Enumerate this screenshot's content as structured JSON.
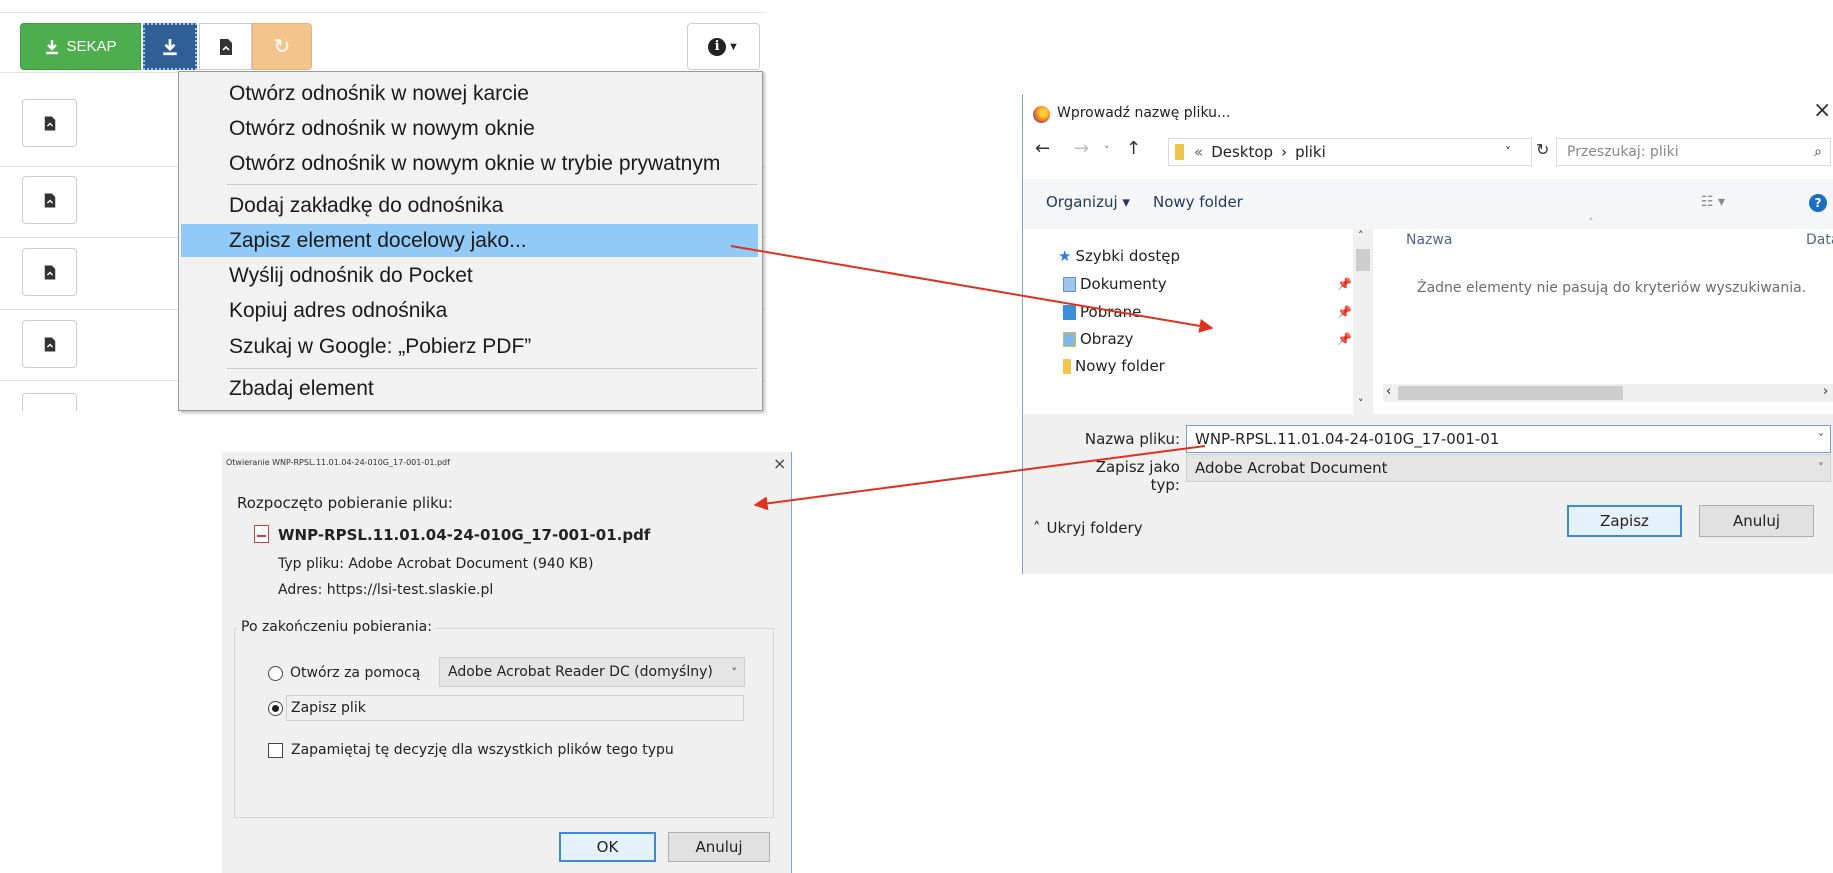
{
  "toolbar": {
    "sekap_label": "SEKAP",
    "refresh_icon": "↻",
    "info_icon": "i"
  },
  "context_menu": {
    "items": [
      {
        "label": "Otwórz odnośnik w nowej karcie",
        "highlighted": false
      },
      {
        "label": "Otwórz odnośnik w nowym oknie",
        "highlighted": false
      },
      {
        "label": "Otwórz odnośnik w nowym oknie w trybie prywatnym",
        "highlighted": false
      },
      {
        "label": "Dodaj zakładkę do odnośnika",
        "highlighted": false
      },
      {
        "label": "Zapisz element docelowy jako...",
        "highlighted": true
      },
      {
        "label": "Wyślij odnośnik do Pocket",
        "highlighted": false
      },
      {
        "label": "Kopiuj adres odnośnika",
        "highlighted": false
      },
      {
        "label": "Szukaj w Google: „Pobierz PDF”",
        "highlighted": false
      },
      {
        "label": "Zbadaj element",
        "highlighted": false
      }
    ]
  },
  "save_dialog": {
    "title": "Wprowadź nazwę pliku...",
    "breadcrumb": [
      "Desktop",
      "pliki"
    ],
    "breadcrumb_prefix": "«",
    "search_placeholder": "Przeszukaj: pliki",
    "organize": "Organizuj ▾",
    "new_folder": "Nowy folder",
    "nav_items": [
      {
        "label": "Szybki dostęp",
        "icon": "star-icon",
        "pinned": false
      },
      {
        "label": "Dokumenty",
        "icon": "documents-folder-icon",
        "pinned": true
      },
      {
        "label": "Pobrane",
        "icon": "downloads-folder-icon",
        "pinned": true
      },
      {
        "label": "Obrazy",
        "icon": "pictures-folder-icon",
        "pinned": true
      },
      {
        "label": "Nowy folder",
        "icon": "folder-icon",
        "pinned": false
      }
    ],
    "col_name": "Nazwa",
    "col_date": "Data",
    "empty_message": "Żadne elementy nie pasują do kryteriów wyszukiwania.",
    "filename_label": "Nazwa pliku:",
    "filename_value": "WNP-RPSL.11.01.04-24-010G_17-001-01",
    "filetype_label": "Zapisz jako typ:",
    "filetype_value": "Adobe Acrobat Document",
    "hide_folders": "Ukryj foldery",
    "save_button": "Zapisz",
    "cancel_button": "Anuluj"
  },
  "download_dialog": {
    "title": "Otwieranie WNP-RPSL.11.01.04-24-010G_17-001-01.pdf",
    "started": "Rozpoczęto pobieranie pliku:",
    "filename": "WNP-RPSL.11.01.04-24-010G_17-001-01.pdf",
    "filetype": "Typ pliku: Adobe Acrobat Document (940 KB)",
    "address": "Adres: https://lsi-test.slaskie.pl",
    "after_label": "Po zakończeniu pobierania:",
    "open_with_label": "Otwórz za pomocą",
    "open_with_app": "Adobe Acrobat Reader DC  (domyślny)",
    "save_file_label": "Zapisz plik",
    "remember_label": "Zapamiętaj tę decyzję dla wszystkich plików tego typu",
    "selected_option": "save",
    "ok_button": "OK",
    "cancel_button": "Anuluj"
  },
  "colors": {
    "sekap_green": "#4cae4c",
    "download_blue": "#2e5f95",
    "refresh_orange": "#f3c48c",
    "menu_highlight": "#91c9f7",
    "arrow_red": "#e0301e"
  }
}
